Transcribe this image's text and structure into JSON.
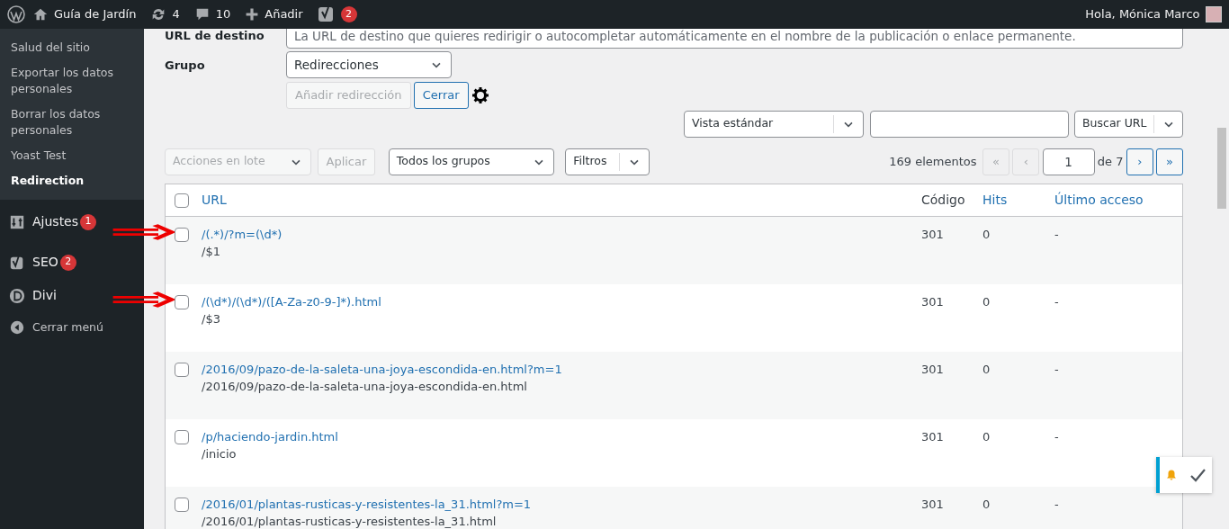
{
  "admin_bar": {
    "site": "Guía de Jardín",
    "updates": "4",
    "comments": "10",
    "new": "Añadir",
    "seo_badge": "2",
    "greeting": "Hola, Mónica Marco"
  },
  "sidebar": {
    "submenu": [
      {
        "label": "Salud del sitio",
        "selected": false
      },
      {
        "label": "Exportar los datos personales",
        "selected": false
      },
      {
        "label": "Borrar los datos personales",
        "selected": false
      },
      {
        "label": "Yoast Test",
        "selected": false
      },
      {
        "label": "Redirection",
        "selected": true
      }
    ],
    "menu": [
      {
        "kind": "settings",
        "label": "Ajustes",
        "badge": "1"
      },
      {
        "kind": "seo",
        "label": "SEO",
        "badge": "2"
      },
      {
        "kind": "divi",
        "label": "Divi"
      },
      {
        "kind": "collapse",
        "label": "Cerrar menú"
      }
    ]
  },
  "form": {
    "target_label": "URL de destino",
    "target_placeholder": "La URL de destino que quieres redirigir o autocompletar automáticamente en el nombre de la publicación o enlace permanente.",
    "group_label": "Grupo",
    "group_value": "Redirecciones",
    "add_button": {
      "label": "Añadir redirección",
      "disabled": true
    },
    "close_button": "Cerrar"
  },
  "search": {
    "view": "Vista estándar",
    "search_type": "Buscar URL"
  },
  "toolbar": {
    "bulk_actions": {
      "label": "Acciones en lote",
      "disabled": true
    },
    "apply": {
      "label": "Aplicar",
      "disabled": true
    },
    "group_filter": "Todos los grupos",
    "filters": "Filtros"
  },
  "pagination": {
    "count": "169 elementos",
    "buttons": [
      {
        "label": "«",
        "disabled": true
      },
      {
        "label": "‹",
        "disabled": true
      }
    ],
    "page": "1",
    "of": "de 7",
    "next_buttons": [
      {
        "label": "›",
        "disabled": false
      },
      {
        "label": "»",
        "disabled": false
      }
    ]
  },
  "table": {
    "select_all_checked": false,
    "columns": [
      {
        "label": "URL",
        "sortable": true
      },
      {
        "label": "Código",
        "sortable": false
      },
      {
        "label": "Hits",
        "sortable": true
      },
      {
        "label": "Último acceso",
        "sortable": true
      }
    ],
    "rows": [
      {
        "source": "/(.*)/?m=(\\d*)",
        "target": "/$1",
        "code": "301",
        "hits": "0",
        "last_access": "-",
        "checked": false,
        "arrow": true
      },
      {
        "source": "/(\\d*)/(\\d*)/([A-Za-z0-9-]*).html",
        "target": "/$3",
        "code": "301",
        "hits": "0",
        "last_access": "-",
        "checked": false,
        "arrow": true
      },
      {
        "source": "/2016/09/pazo-de-la-saleta-una-joya-escondida-en.html?m=1",
        "target": "/2016/09/pazo-de-la-saleta-una-joya-escondida-en.html",
        "code": "301",
        "hits": "0",
        "last_access": "-",
        "checked": false,
        "arrow": false
      },
      {
        "source": "/p/haciendo-jardin.html",
        "target": "/inicio",
        "code": "301",
        "hits": "0",
        "last_access": "-",
        "checked": false,
        "arrow": false
      },
      {
        "source": "/2016/01/plantas-rusticas-y-resistentes-la_31.html?m=1",
        "target": "/2016/01/plantas-rusticas-y-resistentes-la_31.html",
        "code": "301",
        "hits": "0",
        "last_access": "-",
        "checked": false,
        "arrow": false
      }
    ]
  }
}
